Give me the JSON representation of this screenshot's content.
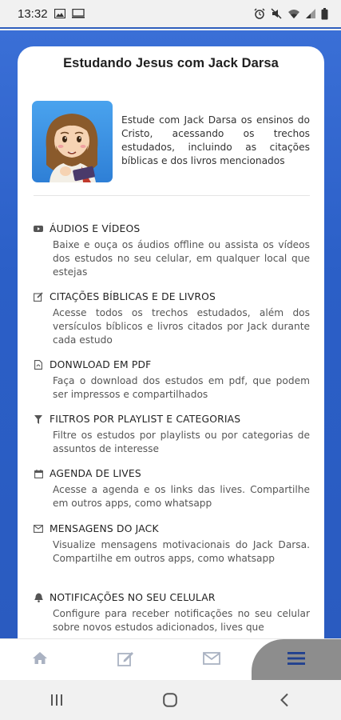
{
  "status_bar": {
    "time": "13:32"
  },
  "card": {
    "title": "Estudando Jesus com Jack Darsa",
    "intro": "Estude com Jack Darsa os ensinos do Cristo, acessando os trechos estudados, incluindo as citações bíblicas e dos livros mencionados"
  },
  "features": [
    {
      "icon": "youtube-icon",
      "title": "ÁUDIOS E VÍDEOS",
      "description": "Baixe e ouça os áudios offline ou assista os vídeos dos estudos no seu celular, em qualquer local que estejas"
    },
    {
      "icon": "edit-icon",
      "title": "CITAÇÕES BÍBLICAS E DE LIVROS",
      "description": "Acesse todos os trechos estudados, além dos versículos bíblicos e livros citados por Jack durante cada estudo"
    },
    {
      "icon": "pdf-file-icon",
      "title": "DONWLOAD EM PDF",
      "description": "Faça o download dos estudos em pdf, que podem ser impressos e compartilhados"
    },
    {
      "icon": "filter-icon",
      "title": "FILTROS POR PLAYLIST E CATEGORIAS",
      "description": "Filtre os estudos por playlists ou por categorias de assuntos de interesse"
    },
    {
      "icon": "calendar-icon",
      "title": "AGENDA DE LIVES",
      "description": "Acesse a agenda e os links das lives. Compartilhe em outros apps, como whatsapp"
    },
    {
      "icon": "envelope-icon",
      "title": "MENSAGENS DO JACK",
      "description": "Visualize mensagens motivacionais do Jack Darsa. Compartilhe em outros apps, como whatsapp"
    },
    {
      "icon": "bell-icon",
      "title": "NOTIFICAÇÕES NO SEU CELULAR",
      "description": "Configure para receber notificações no seu celular sobre novos estudos adicionados, lives que"
    }
  ],
  "colors": {
    "brand_blue": "#2b5fc7",
    "nav_active_bg": "#8d8d8d",
    "nav_active_icon": "#1f3f8f"
  }
}
